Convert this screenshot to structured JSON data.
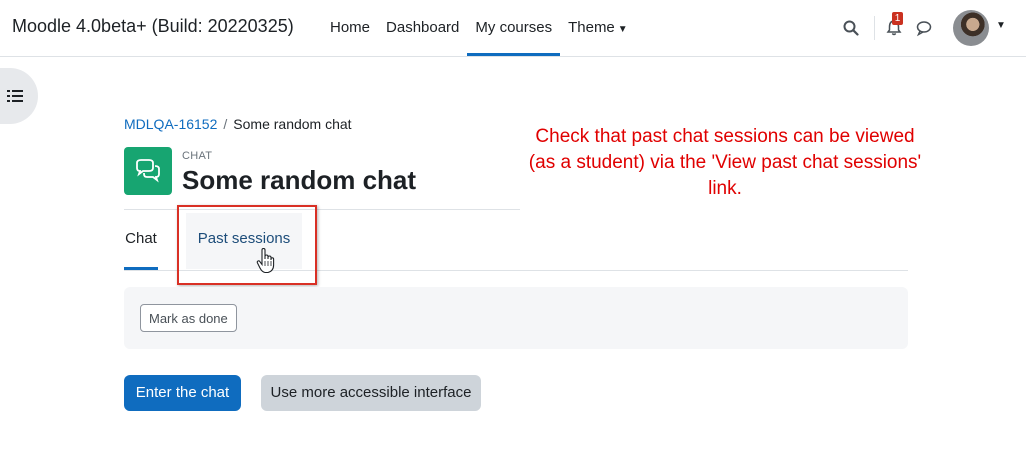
{
  "header": {
    "site_name": "Moodle 4.0beta+ (Build: 20220325)",
    "nav": [
      {
        "label": "Home"
      },
      {
        "label": "Dashboard"
      },
      {
        "label": "My courses",
        "active": true
      },
      {
        "label": "Theme",
        "has_dropdown": true
      }
    ],
    "notification_count": "1",
    "icons": [
      "search-icon",
      "bell-icon",
      "chat-bubble-icon",
      "user-avatar",
      "chevron-down-icon"
    ]
  },
  "breadcrumb": {
    "course": "MDLQA-16152",
    "separator": "/",
    "current": "Some random chat"
  },
  "activity": {
    "module_label": "CHAT",
    "title": "Some random chat",
    "icon": "chat-bubbles-icon",
    "icon_color": "#17a571"
  },
  "annotation": {
    "text": "Check that past chat sessions can be viewed (as a student) via the 'View past chat sessions' link.",
    "color": "#e00000"
  },
  "tabs": [
    {
      "label": "Chat",
      "active": true
    },
    {
      "label": "Past sessions",
      "active": false
    }
  ],
  "completion": {
    "mark_done_label": "Mark as done"
  },
  "actions": {
    "enter_chat": "Enter the chat",
    "accessible_interface": "Use more accessible interface"
  },
  "colors": {
    "primary": "#0f6cbf",
    "highlight_box": "#d93025"
  }
}
